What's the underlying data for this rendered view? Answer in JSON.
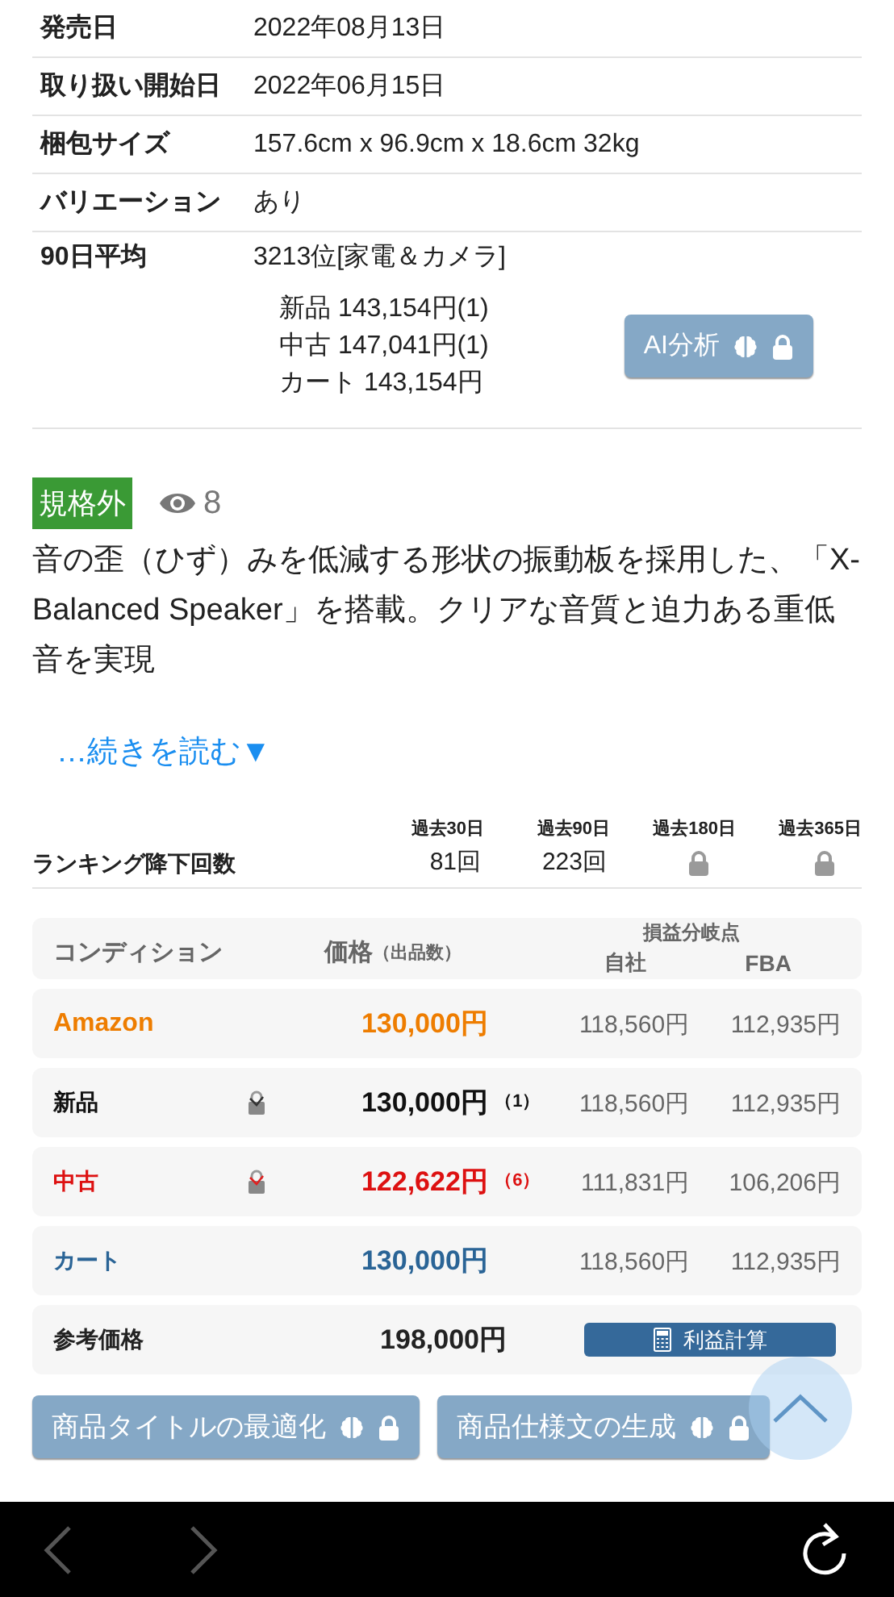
{
  "info_rows": [
    {
      "label": "発売日",
      "value": "2022年08月13日"
    },
    {
      "label": "取り扱い開始日",
      "value": "2022年06月15日"
    },
    {
      "label": "梱包サイズ",
      "value": "157.6cm x 96.9cm x 18.6cm 32kg"
    },
    {
      "label": "バリエーション",
      "value": "あり"
    },
    {
      "label": "90日平均",
      "value": "3213位[家電＆カメラ]"
    }
  ],
  "averages": [
    "新品 143,154円(1)",
    "中古 147,041円(1)",
    "カート 143,154円"
  ],
  "ai_button": {
    "label": "AI分析",
    "locked": true
  },
  "tag": "規格外",
  "views": "8",
  "description": "音の歪（ひず）みを低減する形状の振動板を採用した、「X-Balanced Speaker」を搭載。クリアな音質と迫力ある重低音を実現",
  "read_more": "…続きを読む▼",
  "ranking": {
    "label": "ランキング降下回数",
    "periods": [
      {
        "label": "過去30日",
        "value": "81回",
        "locked": false
      },
      {
        "label": "過去90日",
        "value": "223回",
        "locked": false
      },
      {
        "label": "過去180日",
        "locked": true
      },
      {
        "label": "過去365日",
        "locked": true
      }
    ]
  },
  "price_table": {
    "columns": {
      "condition": "コンディション",
      "price": "価格",
      "count": "（出品数）",
      "breakeven": "損益分岐点",
      "self": "自社",
      "fba": "FBA"
    },
    "rows": [
      {
        "kind": "amazon",
        "condition": "Amazon",
        "price": "130,000円",
        "self": "118,560円",
        "fba": "112,935円"
      },
      {
        "kind": "new",
        "condition": "新品",
        "price": "130,000円",
        "count": "（1）",
        "self": "118,560円",
        "fba": "112,935円"
      },
      {
        "kind": "used",
        "condition": "中古",
        "price": "122,622円",
        "count": "（6）",
        "self": "111,831円",
        "fba": "106,206円"
      },
      {
        "kind": "cart",
        "condition": "カート",
        "price": "130,000円",
        "self": "118,560円",
        "fba": "112,935円"
      }
    ],
    "reference": {
      "label": "参考価格",
      "price": "198,000円",
      "button": "利益計算"
    }
  },
  "actions": [
    {
      "label": "商品タイトルの最適化",
      "locked": true
    },
    {
      "label": "商品仕様文の生成",
      "locked": true
    }
  ]
}
